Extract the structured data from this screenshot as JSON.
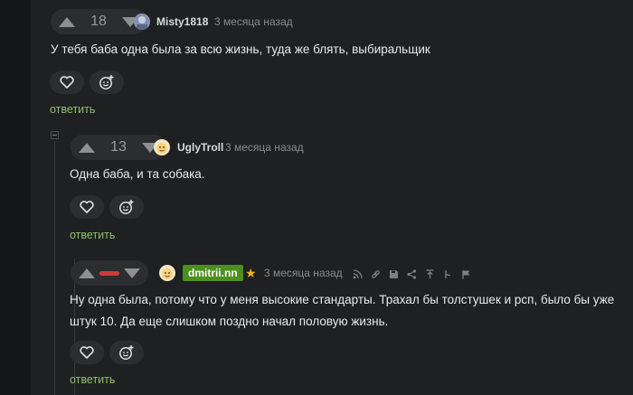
{
  "comments": [
    {
      "score": "18",
      "username": "Misty1818",
      "time": "3 месяца назад",
      "text": "У тебя баба одна была за всю жизнь, туда же блять, выбиральщик",
      "reply_label": "ответить"
    },
    {
      "score": "13",
      "username": "UglyTroll",
      "time": "3 месяца назад",
      "text": "Одна баба, и та собака.",
      "reply_label": "ответить"
    },
    {
      "score_indicator": "negative",
      "username": "dmitrii.nn",
      "time": "3 месяца назад",
      "text": "Ну одна была, потому что у меня высокие стандарты. Трахал бы толстушек и рсп, было бы уже штук 10. Да еще слишком поздно начал половую жизнь.",
      "reply_label": "ответить",
      "toolbar_icons": [
        "share-nodes-icon",
        "link-icon",
        "save-icon",
        "share-icon",
        "scroll-up-icon",
        "branch-icon",
        "flag-icon"
      ]
    }
  ],
  "colors": {
    "page_bg": "#161719",
    "panel_bg": "#1f2022",
    "reply_link": "#8ec06b",
    "author_badge": "#4d8f1f",
    "negative_rating": "#d2383a",
    "star": "#f2b417"
  }
}
